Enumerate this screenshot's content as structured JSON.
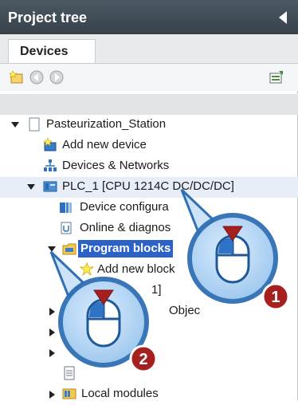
{
  "panel": {
    "title": "Project tree",
    "tab": "Devices"
  },
  "toolbar": {
    "icons": [
      "new-project-icon",
      "back-icon",
      "forward-icon",
      "overview-icon"
    ]
  },
  "tree": {
    "station": "Pasteurization_Station",
    "add_device": "Add new device",
    "devices_networks": "Devices & Networks",
    "plc": "PLC_1 [CPU 1214C DC/DC/DC]",
    "device_config": "Device configura",
    "online_diag": "Online & diagnos",
    "program_blocks": "Program blocks",
    "add_block": "Add new block",
    "partial_item": "1]",
    "objects_partial": "Objec",
    "local_modules": "Local modules"
  },
  "callouts": [
    {
      "number": "1"
    },
    {
      "number": "2"
    }
  ],
  "colors": {
    "titlebar": "#3e4a54",
    "selection": "#2b62c8",
    "callout_number_bg": "#a5201f",
    "callout_ring": "#2f6fb5"
  }
}
